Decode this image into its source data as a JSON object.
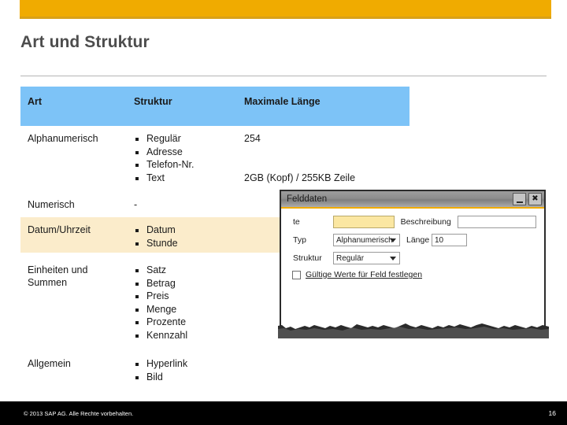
{
  "slide": {
    "title": "Art und Struktur",
    "accent_color": "#f0ab00",
    "header_color": "#7dc3f7",
    "highlight_color": "#fbeccb"
  },
  "table": {
    "headers": {
      "art": "Art",
      "struktur": "Struktur",
      "laenge": "Maximale Länge"
    },
    "rows": [
      {
        "art": "Alphanumerisch",
        "struktur": [
          "Regulär",
          "Adresse",
          "Telefon-Nr.",
          "Text"
        ],
        "laenge_top": "254",
        "laenge_bottom": "2GB (Kopf) / 255KB Zeile",
        "highlight": false
      },
      {
        "art": "Numerisch",
        "struktur_plain": "-",
        "laenge_top": "",
        "highlight": false
      },
      {
        "art": "Datum/Uhrzeit",
        "struktur": [
          "Datum",
          "Stunde"
        ],
        "laenge_top": "",
        "highlight": true
      },
      {
        "art": "Einheiten und Summen",
        "struktur": [
          "Satz",
          "Betrag",
          "Preis",
          "Menge",
          "Prozente",
          "Kennzahl"
        ],
        "laenge_top": "",
        "highlight": false
      },
      {
        "art": "Allgemein",
        "struktur": [
          "Hyperlink",
          "Bild"
        ],
        "laenge_top": "",
        "highlight": false
      }
    ]
  },
  "dialog": {
    "title": "Felddaten",
    "minimize_label": "minimieren",
    "close_label": "schließen",
    "fields": {
      "name_label": "te",
      "name_value": "",
      "desc_label": "Beschreibung",
      "desc_value": "",
      "typ_label": "Typ",
      "typ_value": "Alphanumerisch",
      "laenge_label": "Länge",
      "laenge_value": "10",
      "struktur_label": "Struktur",
      "struktur_value": "Regulär",
      "checkbox_label": "Gültige Werte für Feld festlegen"
    }
  },
  "footer": {
    "copyright": "© 2013 SAP AG. Alle Rechte vorbehalten.",
    "page": "16"
  }
}
